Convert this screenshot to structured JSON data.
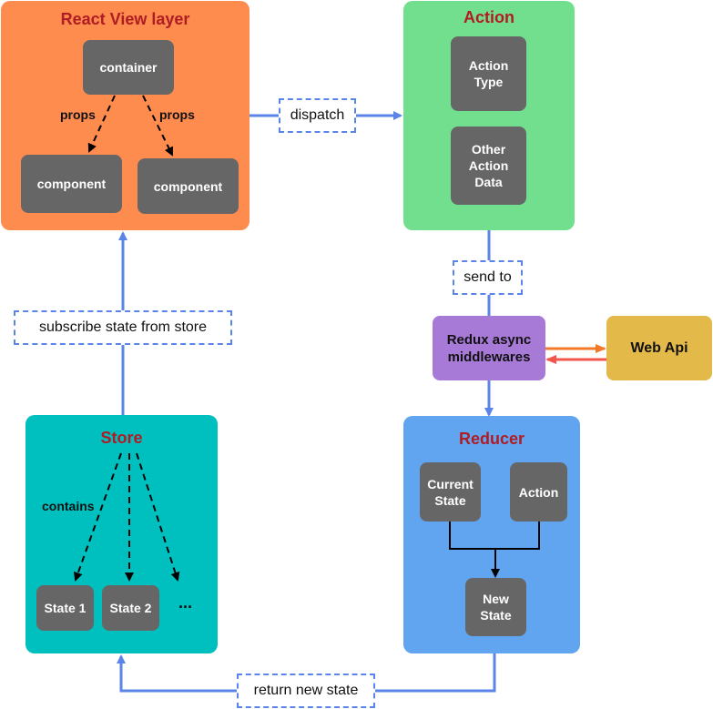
{
  "colors": {
    "view_panel": "#fd8c4e",
    "action_panel": "#72df8e",
    "store_panel": "#00bfbf",
    "reducer_panel": "#61a5f0",
    "middleware": "#a87ad8",
    "web_api": "#e3b94a",
    "node": "#666666",
    "title": "#b01c24",
    "flow_arrow": "#5b84e8",
    "request_arrow": "#f47a2b",
    "response_arrow": "#f2554a"
  },
  "view_layer": {
    "title": "React View layer",
    "container": "container",
    "component_left": "component",
    "component_right": "component",
    "props_left": "props",
    "props_right": "props"
  },
  "action": {
    "title": "Action",
    "type": "Action Type",
    "data": "Other Action Data"
  },
  "store": {
    "title": "Store",
    "contains": "contains",
    "state1": "State 1",
    "state2": "State 2",
    "more": "..."
  },
  "reducer": {
    "title": "Reducer",
    "current_state": "Current State",
    "action": "Action",
    "new_state": "New State"
  },
  "middleware": {
    "label": "Redux async middlewares"
  },
  "web_api": {
    "label": "Web Api"
  },
  "flows": {
    "dispatch": "dispatch",
    "send_to": "send to",
    "subscribe": "subscribe state from store",
    "return_state": "return new state"
  }
}
